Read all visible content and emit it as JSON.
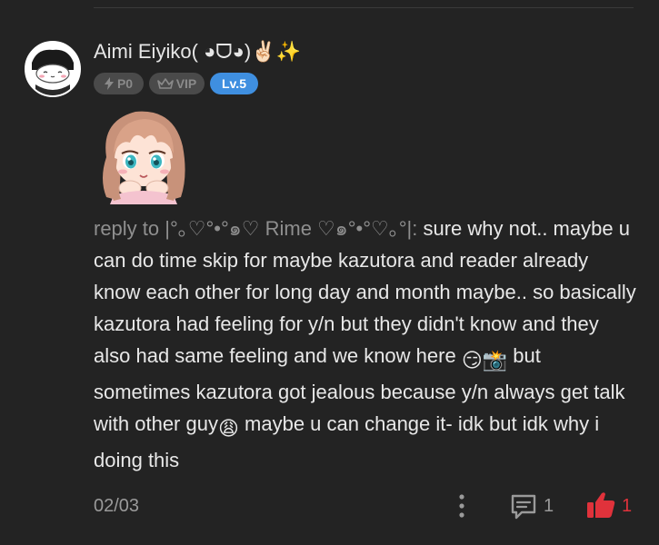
{
  "comment": {
    "author": {
      "name": "Aimi Eiyiko( ◕ᗜ◕)✌🏻✨",
      "avatar_icon": "avatar-drawing"
    },
    "badges": [
      {
        "label": "P0",
        "icon": "lightning-icon",
        "color": "#8a8a8a"
      },
      {
        "label": "VIP",
        "icon": "crown-icon",
        "color": "#8a8a8a"
      },
      {
        "label": "Lv.5",
        "color": "#3f8fe0"
      }
    ],
    "sticker": "anime-girl-sticker",
    "reply_prefix": "reply to |°｡♡°•°๑♡ Rime ♡๑°•°♡｡°|:",
    "text_part1": " sure why not.. maybe u can do time skip for maybe kazutora and reader already know each other for long day and month maybe.. so basically kazutora had feeling for y/n but they didn't know and they also had same feeling and we know here ",
    "emoji1": "😏📸",
    "text_part2": " but sometimes kazutora got jealous because y/n always get talk with other guy",
    "emoji2": "😩",
    "text_part3": " maybe u can change it- idk but idk why i doing this",
    "date": "02/03",
    "reply_count": "1",
    "like_count": "1"
  },
  "colors": {
    "background": "#232323",
    "accent_blue": "#3f8fe0",
    "like_red": "#e0323b"
  }
}
